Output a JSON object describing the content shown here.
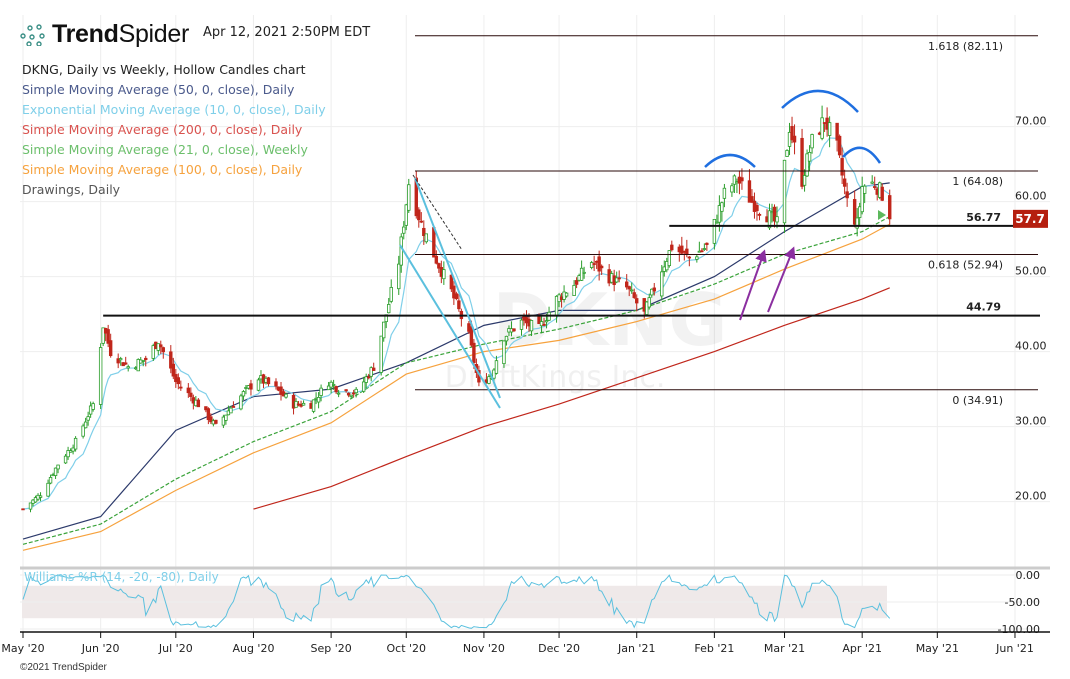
{
  "header": {
    "brand_bold": "Trend",
    "brand_light": "Spider",
    "timestamp": "Apr 12, 2021 2:50PM EDT"
  },
  "legend": {
    "title": "DKNG, Daily vs Weekly, Hollow Candles chart",
    "items": [
      {
        "label": "Simple Moving Average (50, 0, close), Daily",
        "color": "#4b5a8c"
      },
      {
        "label": "Exponential Moving Average (10, 0, close), Daily",
        "color": "#7fcfe9"
      },
      {
        "label": "Simple Moving Average (200, 0, close), Daily",
        "color": "#d9534f"
      },
      {
        "label": "Simple Moving Average (21, 0, close), Weekly",
        "color": "#6cbf6c"
      },
      {
        "label": "Simple Moving Average (100, 0, close), Daily",
        "color": "#f6a23e"
      },
      {
        "label": "Drawings, Daily",
        "color": "#555555"
      }
    ]
  },
  "watermark": {
    "symbol": "DKNG",
    "name": "DraftKings Inc."
  },
  "footer": {
    "copyright": "©2021 TrendSpider"
  },
  "chart_data": {
    "type": "candlestick",
    "symbol": "DKNG",
    "last_price": "57.7",
    "colors": {
      "up": "#2a9d2a",
      "down": "#c0261b",
      "last_price_bg": "#b51f0f",
      "williams": "#5bc0de"
    },
    "y_ticks": [
      "70.00",
      "60.00",
      "50.00",
      "40.00",
      "30.00",
      "20.00"
    ],
    "y_tick_values": [
      70,
      60,
      50,
      40,
      30,
      20
    ],
    "x_ticks": [
      {
        "label": "May '20",
        "date": "2020-05-01"
      },
      {
        "label": "Jun '20",
        "date": "2020-06-01"
      },
      {
        "label": "Jul '20",
        "date": "2020-07-01"
      },
      {
        "label": "Aug '20",
        "date": "2020-08-01"
      },
      {
        "label": "Sep '20",
        "date": "2020-09-01"
      },
      {
        "label": "Oct '20",
        "date": "2020-10-01"
      },
      {
        "label": "Nov '20",
        "date": "2020-11-01"
      },
      {
        "label": "Dec '20",
        "date": "2020-12-01"
      },
      {
        "label": "Jan '21",
        "date": "2021-01-01"
      },
      {
        "label": "Feb '21",
        "date": "2021-02-01"
      },
      {
        "label": "Mar '21",
        "date": "2021-03-01"
      },
      {
        "label": "Apr '21",
        "date": "2021-04-01"
      },
      {
        "label": "May '21",
        "date": "2021-05-01"
      },
      {
        "label": "Jun '21",
        "date": "2021-06-01"
      }
    ],
    "close_keypoints": [
      [
        "2020-05-01",
        19
      ],
      [
        "2020-05-08",
        21
      ],
      [
        "2020-05-15",
        25
      ],
      [
        "2020-05-22",
        28
      ],
      [
        "2020-05-29",
        33
      ],
      [
        "2020-06-02",
        43.5
      ],
      [
        "2020-06-05",
        40
      ],
      [
        "2020-06-12",
        38
      ],
      [
        "2020-06-19",
        39
      ],
      [
        "2020-06-24",
        41.5
      ],
      [
        "2020-07-01",
        36
      ],
      [
        "2020-07-10",
        33
      ],
      [
        "2020-07-17",
        30
      ],
      [
        "2020-07-24",
        33
      ],
      [
        "2020-08-03",
        36.5
      ],
      [
        "2020-08-10",
        35
      ],
      [
        "2020-08-17",
        33
      ],
      [
        "2020-08-24",
        33
      ],
      [
        "2020-08-31",
        36
      ],
      [
        "2020-09-04",
        35
      ],
      [
        "2020-09-11",
        34.5
      ],
      [
        "2020-09-18",
        38
      ],
      [
        "2020-09-23",
        45
      ],
      [
        "2020-09-28",
        52
      ],
      [
        "2020-10-02",
        62.5
      ],
      [
        "2020-10-07",
        57
      ],
      [
        "2020-10-12",
        53
      ],
      [
        "2020-10-19",
        48
      ],
      [
        "2020-10-26",
        42
      ],
      [
        "2020-10-30",
        35.5
      ],
      [
        "2020-11-04",
        37
      ],
      [
        "2020-11-09",
        42
      ],
      [
        "2020-11-16",
        44
      ],
      [
        "2020-11-23",
        43
      ],
      [
        "2020-11-30",
        47
      ],
      [
        "2020-12-07",
        49
      ],
      [
        "2020-12-14",
        52
      ],
      [
        "2020-12-21",
        50
      ],
      [
        "2020-12-28",
        48.5
      ],
      [
        "2021-01-04",
        45
      ],
      [
        "2021-01-11",
        51
      ],
      [
        "2021-01-15",
        54
      ],
      [
        "2021-01-22",
        52.5
      ],
      [
        "2021-01-29",
        54
      ],
      [
        "2021-02-05",
        61
      ],
      [
        "2021-02-10",
        63
      ],
      [
        "2021-02-16",
        60
      ],
      [
        "2021-02-23",
        58
      ],
      [
        "2021-02-26",
        57
      ],
      [
        "2021-03-03",
        70
      ],
      [
        "2021-03-08",
        63
      ],
      [
        "2021-03-12",
        68
      ],
      [
        "2021-03-17",
        71
      ],
      [
        "2021-03-22",
        67
      ],
      [
        "2021-03-26",
        60
      ],
      [
        "2021-03-30",
        57
      ],
      [
        "2021-04-01",
        62
      ],
      [
        "2021-04-06",
        62.5
      ],
      [
        "2021-04-09",
        61
      ],
      [
        "2021-04-12",
        57.7
      ]
    ],
    "moving_averages": [
      {
        "name": "SMA 50 Daily",
        "color": "#2c3a6b",
        "dash": false,
        "points": [
          [
            "2020-05-01",
            15
          ],
          [
            "2020-06-01",
            18
          ],
          [
            "2020-07-01",
            29.5
          ],
          [
            "2020-08-01",
            34
          ],
          [
            "2020-09-01",
            35
          ],
          [
            "2020-10-01",
            38.5
          ],
          [
            "2020-11-01",
            43.5
          ],
          [
            "2020-12-01",
            45.5
          ],
          [
            "2021-01-01",
            45.5
          ],
          [
            "2021-02-01",
            50
          ],
          [
            "2021-03-01",
            56
          ],
          [
            "2021-04-01",
            62
          ],
          [
            "2021-04-12",
            62.5
          ]
        ]
      },
      {
        "name": "SMA 100 Daily",
        "color": "#f6a23e",
        "dash": false,
        "points": [
          [
            "2020-05-01",
            13.5
          ],
          [
            "2020-06-01",
            16
          ],
          [
            "2020-07-01",
            21.5
          ],
          [
            "2020-08-01",
            26.5
          ],
          [
            "2020-09-01",
            30.5
          ],
          [
            "2020-10-01",
            37
          ],
          [
            "2020-11-01",
            40
          ],
          [
            "2020-12-01",
            41.5
          ],
          [
            "2021-01-01",
            44
          ],
          [
            "2021-02-01",
            47
          ],
          [
            "2021-03-01",
            51
          ],
          [
            "2021-04-01",
            55
          ],
          [
            "2021-04-12",
            57
          ]
        ]
      },
      {
        "name": "SMA 21 Weekly",
        "color": "#3aa33a",
        "dash": true,
        "points": [
          [
            "2020-05-01",
            14.3
          ],
          [
            "2020-06-01",
            17
          ],
          [
            "2020-07-01",
            23
          ],
          [
            "2020-08-01",
            28
          ],
          [
            "2020-09-01",
            32
          ],
          [
            "2020-10-01",
            38.5
          ],
          [
            "2020-11-01",
            41
          ],
          [
            "2020-12-01",
            43
          ],
          [
            "2021-01-01",
            45.5
          ],
          [
            "2021-02-01",
            49
          ],
          [
            "2021-03-01",
            53
          ],
          [
            "2021-04-01",
            56
          ],
          [
            "2021-04-12",
            58
          ]
        ]
      },
      {
        "name": "SMA 200 Daily",
        "color": "#c0261b",
        "dash": false,
        "points": [
          [
            "2020-08-01",
            19
          ],
          [
            "2020-09-01",
            22
          ],
          [
            "2020-10-01",
            26
          ],
          [
            "2020-11-01",
            30
          ],
          [
            "2020-12-01",
            33
          ],
          [
            "2021-01-01",
            36.5
          ],
          [
            "2021-02-01",
            40
          ],
          [
            "2021-03-01",
            43.5
          ],
          [
            "2021-04-01",
            47
          ],
          [
            "2021-04-12",
            48.5
          ]
        ]
      }
    ],
    "fib_levels": [
      {
        "label": "1.618 (82.11)",
        "value": 82.11
      },
      {
        "label": "1 (64.08)",
        "value": 64.08
      },
      {
        "label": "0.618 (52.94)",
        "value": 52.94
      },
      {
        "label": "0 (34.91)",
        "value": 34.91
      }
    ],
    "support_levels": [
      {
        "label": "56.77",
        "value": 56.77,
        "from": "2021-01-14"
      },
      {
        "label": "44.79",
        "value": 44.79,
        "from": "2020-06-02"
      }
    ],
    "williams": {
      "label": "Williams %R (14, -20, -80), Daily",
      "y_ticks": [
        "0.00",
        "-50.00",
        "-100.00"
      ],
      "y_tick_values": [
        0,
        -50,
        -100
      ],
      "band": [
        -20,
        -80
      ]
    }
  }
}
